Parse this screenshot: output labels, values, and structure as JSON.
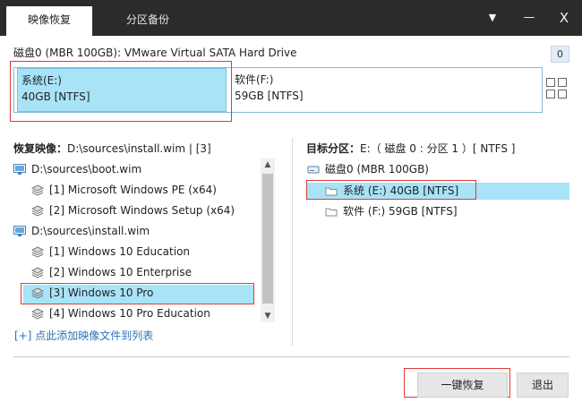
{
  "window": {
    "tabs": [
      {
        "label": "映像恢复",
        "active": true
      },
      {
        "label": "分区备份",
        "active": false
      }
    ],
    "controls": {
      "dropdown": "▼",
      "minimize": "—",
      "close": "X"
    }
  },
  "disk": {
    "title": "磁盘0 (MBR 100GB): VMware Virtual SATA Hard Drive",
    "badge": "0",
    "partitions": [
      {
        "name": "系统(E:)",
        "size": "40GB [NTFS]",
        "selected": true
      },
      {
        "name": "软件(F:)",
        "size": "59GB [NTFS]",
        "selected": false
      }
    ]
  },
  "left_panel": {
    "heading_label": "恢复映像：",
    "heading_value": "D:\\sources\\install.wim | [3]",
    "tree": [
      {
        "label": "D:\\sources\\boot.wim",
        "level": 0,
        "icon": "monitor-icon"
      },
      {
        "label": "[1] Microsoft Windows PE (x64)",
        "level": 1,
        "icon": "layers-icon"
      },
      {
        "label": "[2] Microsoft Windows Setup (x64)",
        "level": 1,
        "icon": "layers-icon"
      },
      {
        "label": "D:\\sources\\install.wim",
        "level": 0,
        "icon": "monitor-icon"
      },
      {
        "label": "[1] Windows 10 Education",
        "level": 1,
        "icon": "layers-icon"
      },
      {
        "label": "[2] Windows 10 Enterprise",
        "level": 1,
        "icon": "layers-icon"
      },
      {
        "label": "[3] Windows 10 Pro",
        "level": 1,
        "icon": "layers-icon",
        "selected": true
      },
      {
        "label": "[4] Windows 10 Pro Education",
        "level": 1,
        "icon": "layers-icon"
      }
    ],
    "add_link": "[+] 点此添加映像文件到列表"
  },
  "right_panel": {
    "heading_label": "目标分区：",
    "heading_value": "E:（ 磁盘 0 : 分区 1 ）[ NTFS ]",
    "tree": [
      {
        "label": "磁盘0 (MBR 100GB)",
        "level": 0,
        "icon": "disk-icon"
      },
      {
        "label": "系统 (E:) 40GB [NTFS]",
        "level": 1,
        "icon": "folder-icon",
        "selected": true
      },
      {
        "label": "软件 (F:) 59GB [NTFS]",
        "level": 1,
        "icon": "folder-icon"
      }
    ]
  },
  "buttons": {
    "restore": "一键恢复",
    "exit": "退出"
  },
  "colors": {
    "titlebar": "#2b2b2b",
    "selection": "#a8e3f8",
    "highlight_border": "#e03a3a",
    "link": "#2d72b8"
  }
}
